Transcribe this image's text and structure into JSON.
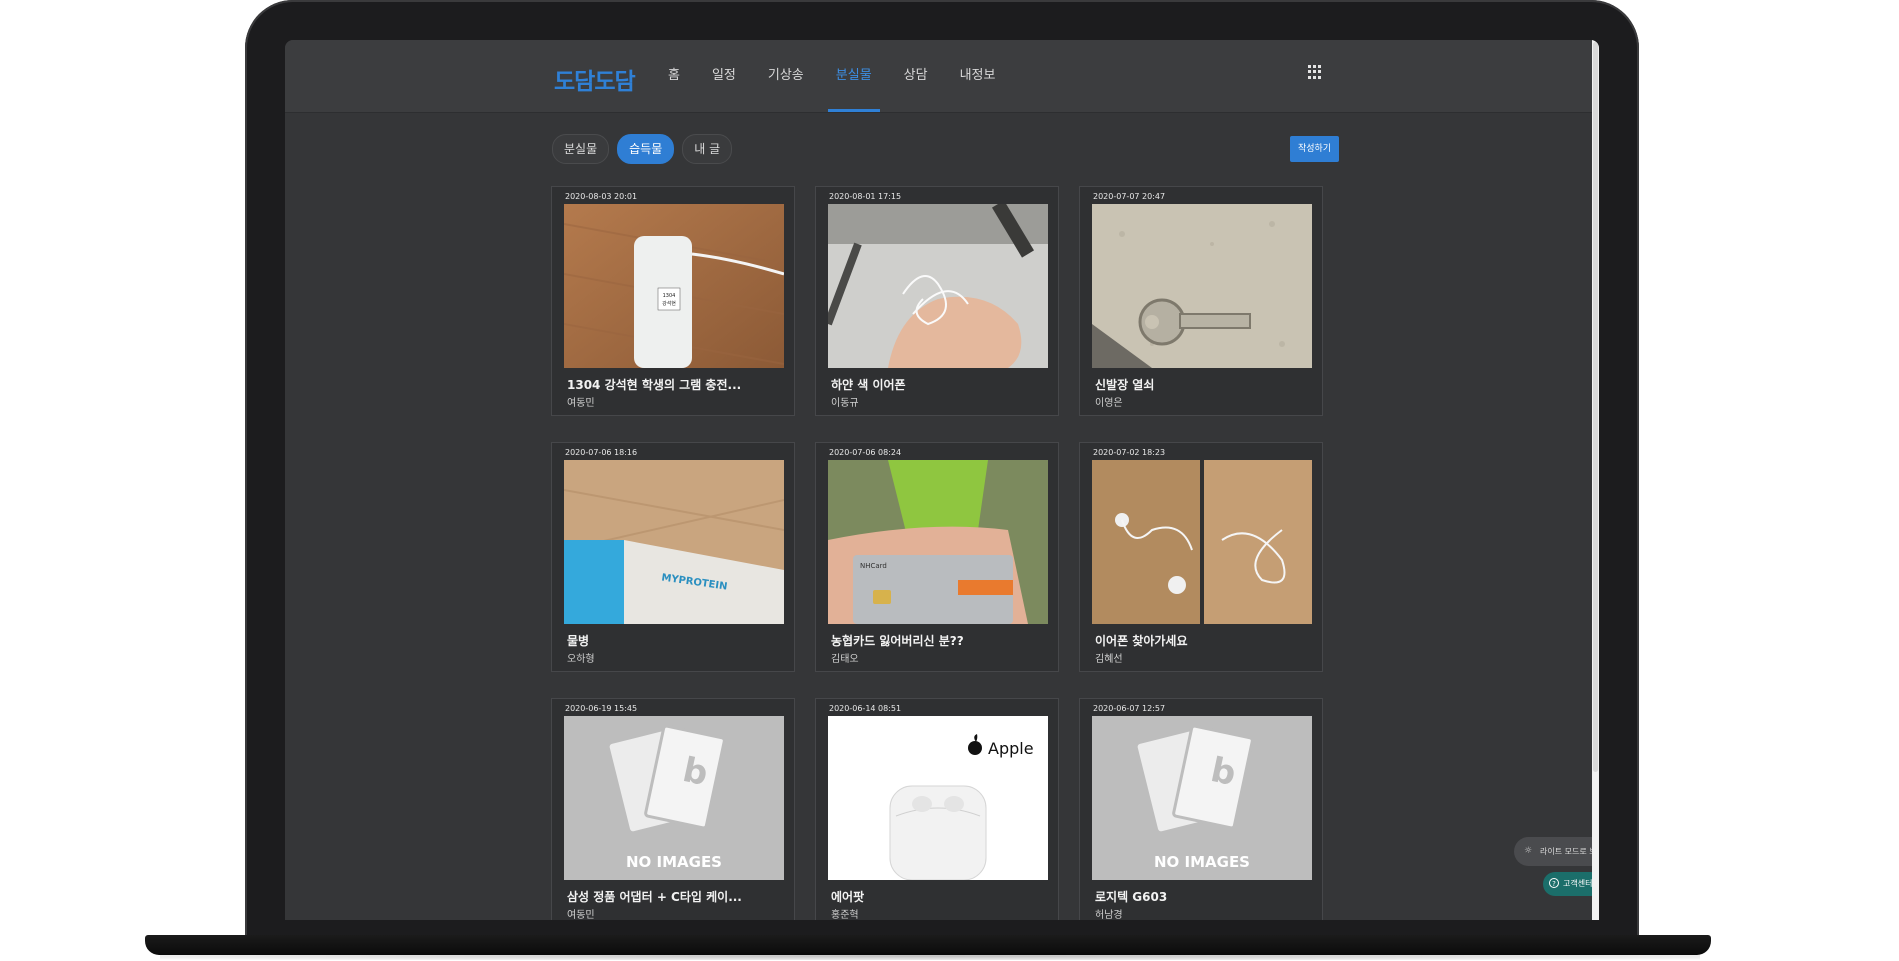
{
  "app": {
    "logo": "도담도담"
  },
  "nav": {
    "items": [
      {
        "label": "홈"
      },
      {
        "label": "일정"
      },
      {
        "label": "기상송"
      },
      {
        "label": "분실물"
      },
      {
        "label": "상담"
      },
      {
        "label": "내정보"
      }
    ],
    "active_index": 3
  },
  "tabs": {
    "items": [
      {
        "label": "분실물"
      },
      {
        "label": "습득물"
      },
      {
        "label": "내 글"
      }
    ],
    "active_index": 1,
    "write_label": "작성하기"
  },
  "posts": [
    {
      "date": "2020-08-03 20:01",
      "title": "1304 강석현 학생의 그램 충전...",
      "author": "여동민",
      "image": "charger"
    },
    {
      "date": "2020-08-01 17:15",
      "title": "하얀 색 이어폰",
      "author": "이동규",
      "image": "earphones-hand"
    },
    {
      "date": "2020-07-07 20:47",
      "title": "신발장 열쇠",
      "author": "이영은",
      "image": "key"
    },
    {
      "date": "2020-07-06 18:16",
      "title": "물병",
      "author": "오하형",
      "image": "bottle"
    },
    {
      "date": "2020-07-06 08:24",
      "title": "농협카드 잃어버리신 분??",
      "author": "김태오",
      "image": "card"
    },
    {
      "date": "2020-07-02 18:23",
      "title": "이어폰 찾아가세요",
      "author": "김혜선",
      "image": "earphones-two"
    },
    {
      "date": "2020-06-19 15:45",
      "title": "삼성 정품 어댑터 + C타입 케이...",
      "author": "여동민",
      "image": "no-image"
    },
    {
      "date": "2020-06-14 08:51",
      "title": "에어팟",
      "author": "홍준혁",
      "image": "airpods"
    },
    {
      "date": "2020-06-07 12:57",
      "title": "로지텍 G603",
      "author": "허남경",
      "image": "no-image"
    }
  ],
  "image_text": {
    "charger_label_line1": "1304",
    "charger_label_line2": "강석현",
    "bottle_brand": "MYPROTEIN",
    "card_brand": "NHCard",
    "apple_brand": "Apple",
    "no_image": "NO IMAGES"
  },
  "floating": {
    "mode_label": "라이트 모드로 보기",
    "help_label": "고객센터"
  },
  "colors": {
    "accent": "#2f7ed4",
    "background": "#353638",
    "help": "#1b6e6a"
  }
}
